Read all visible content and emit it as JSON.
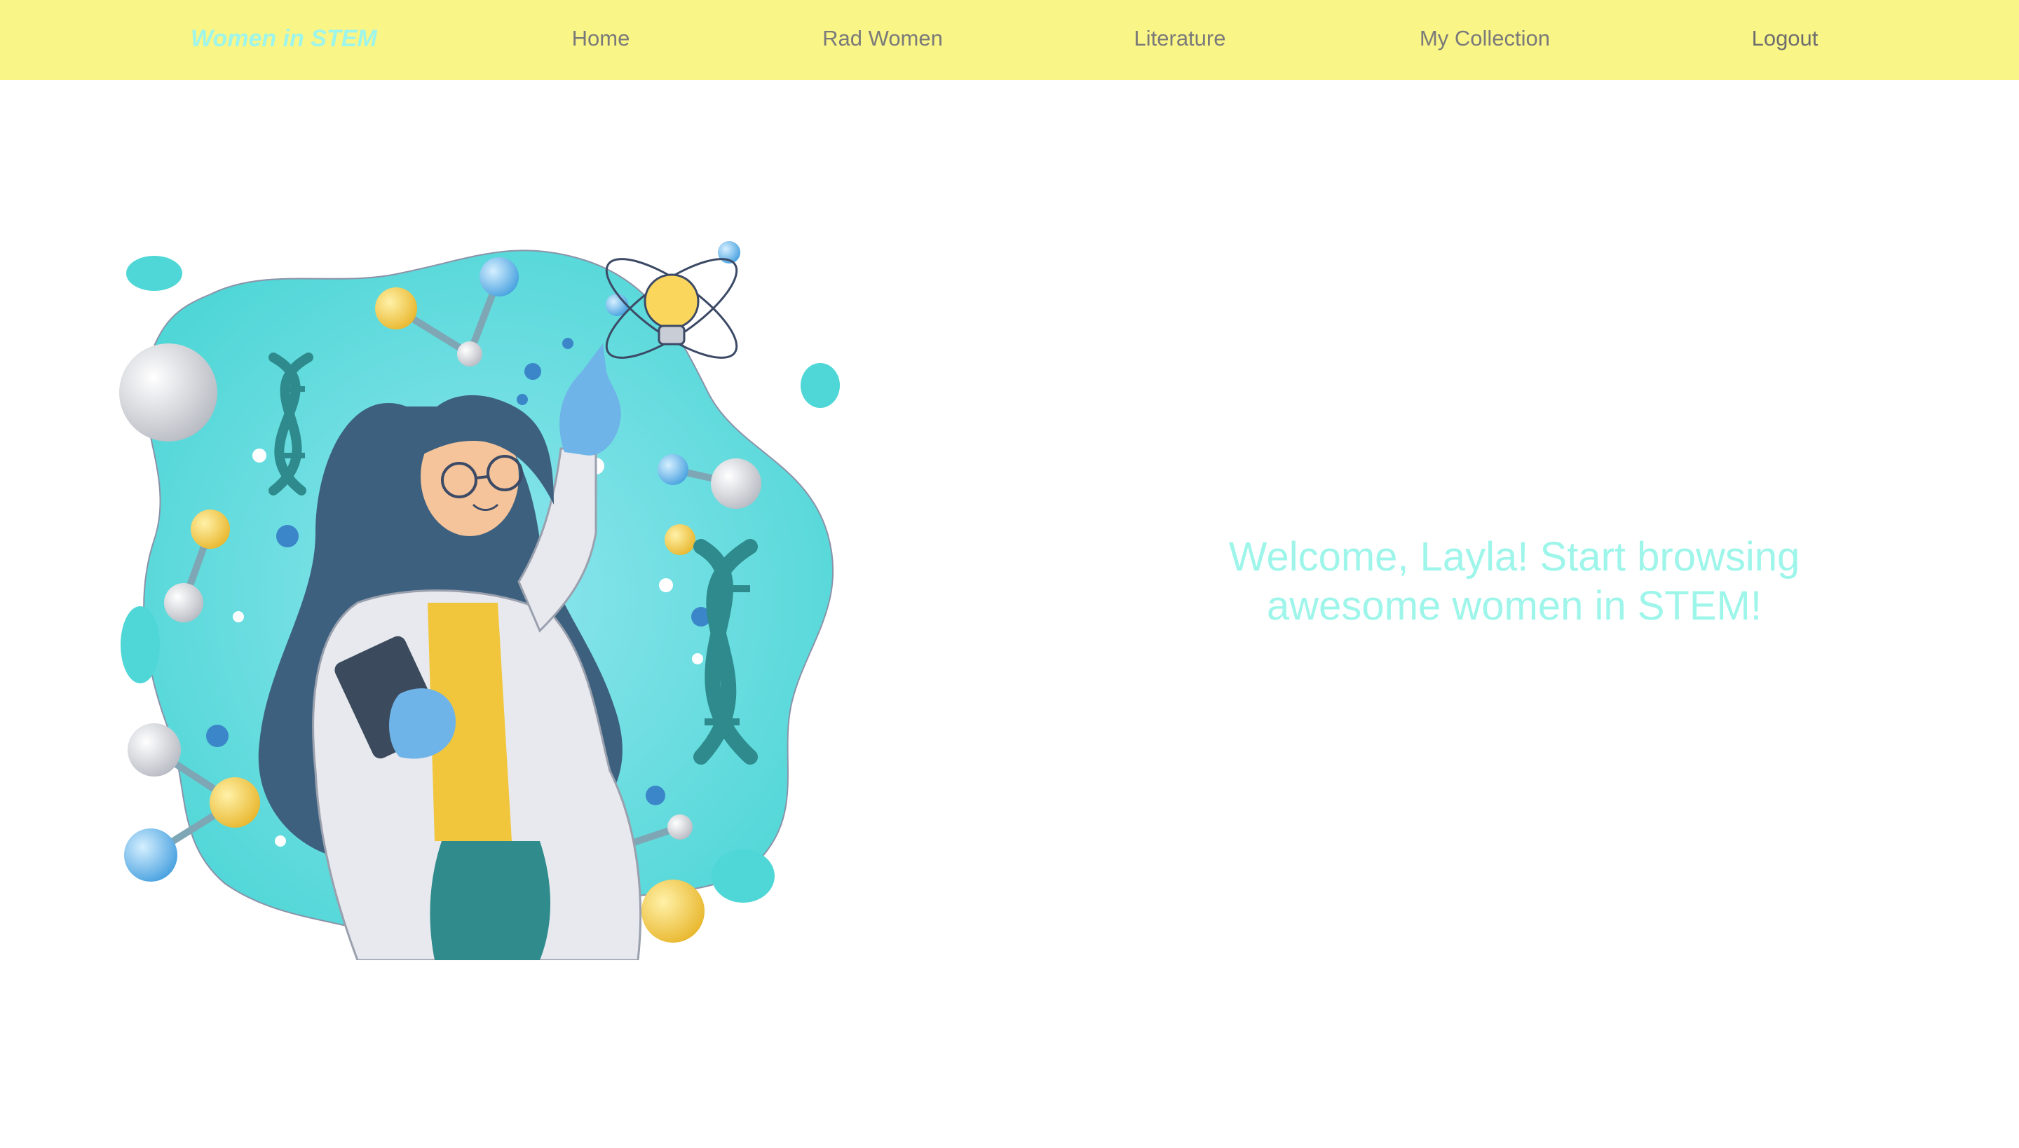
{
  "nav": {
    "brand": "Women in STEM",
    "items": [
      {
        "label": "Home"
      },
      {
        "label": "Rad Women"
      },
      {
        "label": "Literature"
      },
      {
        "label": "My Collection"
      },
      {
        "label": "Logout"
      }
    ]
  },
  "hero": {
    "illustration": "woman-scientist-illustration",
    "welcome_line1": "Welcome, Layla! Start browsing",
    "welcome_line2": "awesome women in STEM!"
  },
  "colors": {
    "navbar_bg": "#faf587",
    "accent": "#9ef5ea",
    "nav_text": "#7a7a7a"
  }
}
